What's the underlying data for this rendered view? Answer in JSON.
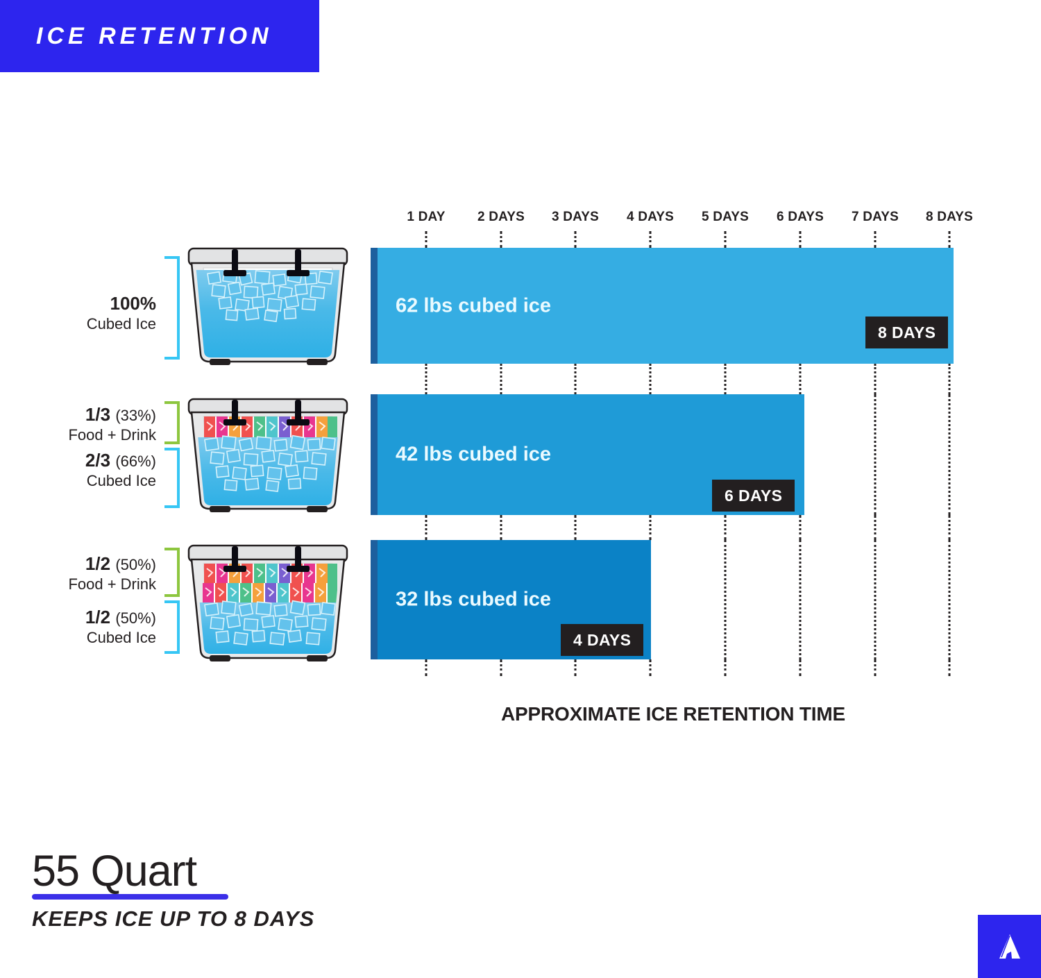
{
  "banner": {
    "title": "ICE RETENTION"
  },
  "chart_data": {
    "type": "bar",
    "title": "ICE RETENTION",
    "xlabel": "APPROXIMATE ICE RETENTION TIME",
    "ylabel": "",
    "xlim": [
      0,
      8
    ],
    "grid": true,
    "orientation": "horizontal",
    "tick_labels": [
      "1 DAY",
      "2 DAYS",
      "3 DAYS",
      "4 DAYS",
      "5 DAYS",
      "6 DAYS",
      "7 DAYS",
      "8 DAYS"
    ],
    "tick_values": [
      1,
      2,
      3,
      4,
      5,
      6,
      7,
      8
    ],
    "categories": [
      "100% Cubed Ice",
      "2/3 Cubed Ice + 1/3 Food + Drink",
      "1/2 Cubed Ice + 1/2 Food + Drink"
    ],
    "values": [
      8,
      6,
      4
    ],
    "bars": [
      {
        "label": "62 lbs cubed ice",
        "ice_weight_lbs": 62,
        "days": 8,
        "badge": "8 DAYS",
        "color": "#35ade3"
      },
      {
        "label": "42 lbs cubed ice",
        "ice_weight_lbs": 42,
        "days": 6,
        "badge": "6 DAYS",
        "color": "#1f9bd7"
      },
      {
        "label": "32 lbs cubed ice",
        "ice_weight_lbs": 32,
        "days": 4,
        "badge": "4 DAYS",
        "color": "#0b82c6"
      }
    ]
  },
  "axis": {
    "caption": "APPROXIMATE ICE RETENTION TIME",
    "ticks": [
      "1 DAY",
      "2 DAYS",
      "3 DAYS",
      "4 DAYS",
      "5 DAYS",
      "6 DAYS",
      "7 DAYS",
      "8 DAYS"
    ]
  },
  "rows": [
    {
      "groups": [
        {
          "pct": "100%",
          "paren": "",
          "sub": "Cubed Ice",
          "bracket_color": "#36c6f4"
        }
      ]
    },
    {
      "groups": [
        {
          "pct": "1/3",
          "paren": "(33%)",
          "sub": "Food + Drink",
          "bracket_color": "#8dc63f"
        },
        {
          "pct": "2/3",
          "paren": "(66%)",
          "sub": "Cubed Ice",
          "bracket_color": "#36c6f4"
        }
      ]
    },
    {
      "groups": [
        {
          "pct": "1/2",
          "paren": "(50%)",
          "sub": "Food + Drink",
          "bracket_color": "#8dc63f"
        },
        {
          "pct": "1/2",
          "paren": "(50%)",
          "sub": "Cubed Ice",
          "bracket_color": "#36c6f4"
        }
      ]
    }
  ],
  "footer": {
    "size": "55 Quart",
    "tagline": "KEEPS ICE UP TO 8 DAYS",
    "logo_icon": "mountain-peak-logo"
  },
  "colors": {
    "brand_blue": "#2d25ee",
    "bar_1": "#35ade3",
    "bar_2": "#1f9bd7",
    "bar_3": "#0b82c6",
    "bar_edge": "#1d5f9e",
    "badge_bg": "#231f20",
    "bracket_blue": "#36c6f4",
    "bracket_green": "#8dc63f",
    "text_dark": "#231f20"
  }
}
